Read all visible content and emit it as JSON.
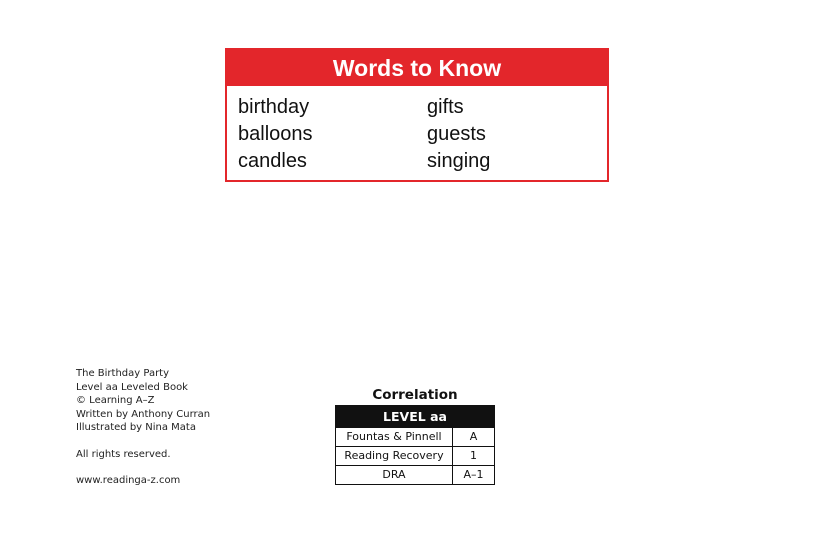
{
  "words_to_know": {
    "title": "Words to Know",
    "left_column": [
      "birthday",
      "balloons",
      "candles"
    ],
    "right_column": [
      "gifts",
      "guests",
      "singing"
    ],
    "accent_color": "#e3262b"
  },
  "credits": {
    "lines": [
      "The Birthday Party",
      "Level aa Leveled Book",
      "© Learning A–Z",
      "Written by Anthony Curran",
      "Illustrated by Nina Mata"
    ],
    "rights": "All rights reserved.",
    "website": "www.readinga-z.com"
  },
  "correlation": {
    "title": "Correlation",
    "level_label": "LEVEL aa",
    "rows": [
      {
        "name": "Fountas & Pinnell",
        "value": "A"
      },
      {
        "name": "Reading Recovery",
        "value": "1"
      },
      {
        "name": "DRA",
        "value": "A–1"
      }
    ]
  }
}
